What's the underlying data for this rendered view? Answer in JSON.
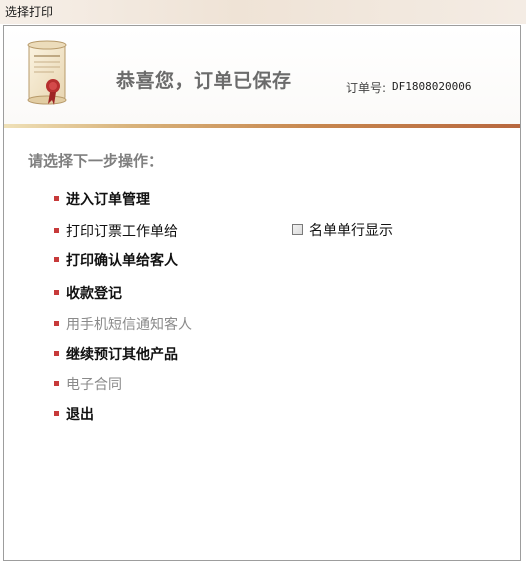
{
  "window": {
    "title": "选择打印"
  },
  "header": {
    "headline": "恭喜您，订单已保存",
    "order_label": "订单号:",
    "order_number": "DF1808020006",
    "certificate_icon": "certificate-scroll-icon"
  },
  "section": {
    "title": "请选择下一步操作："
  },
  "menu": [
    {
      "label": "进入订单管理",
      "enabled": true
    },
    {
      "label": "打印订票工作单给",
      "enabled": true
    },
    {
      "label": "打印确认单给客人",
      "enabled": true
    },
    {
      "label": "收款登记",
      "enabled": true
    },
    {
      "label": "用手机短信通知客人",
      "enabled": false
    },
    {
      "label": "继续预订其他产品",
      "enabled": true
    },
    {
      "label": "电子合同",
      "enabled": false
    },
    {
      "label": "退出",
      "enabled": true
    }
  ],
  "checkbox": {
    "label": "名单单行显示",
    "checked": false
  },
  "colors": {
    "bullet": "#c73a3a",
    "divider_end": "#b8683f",
    "disabled_text": "#8a8a8a"
  }
}
